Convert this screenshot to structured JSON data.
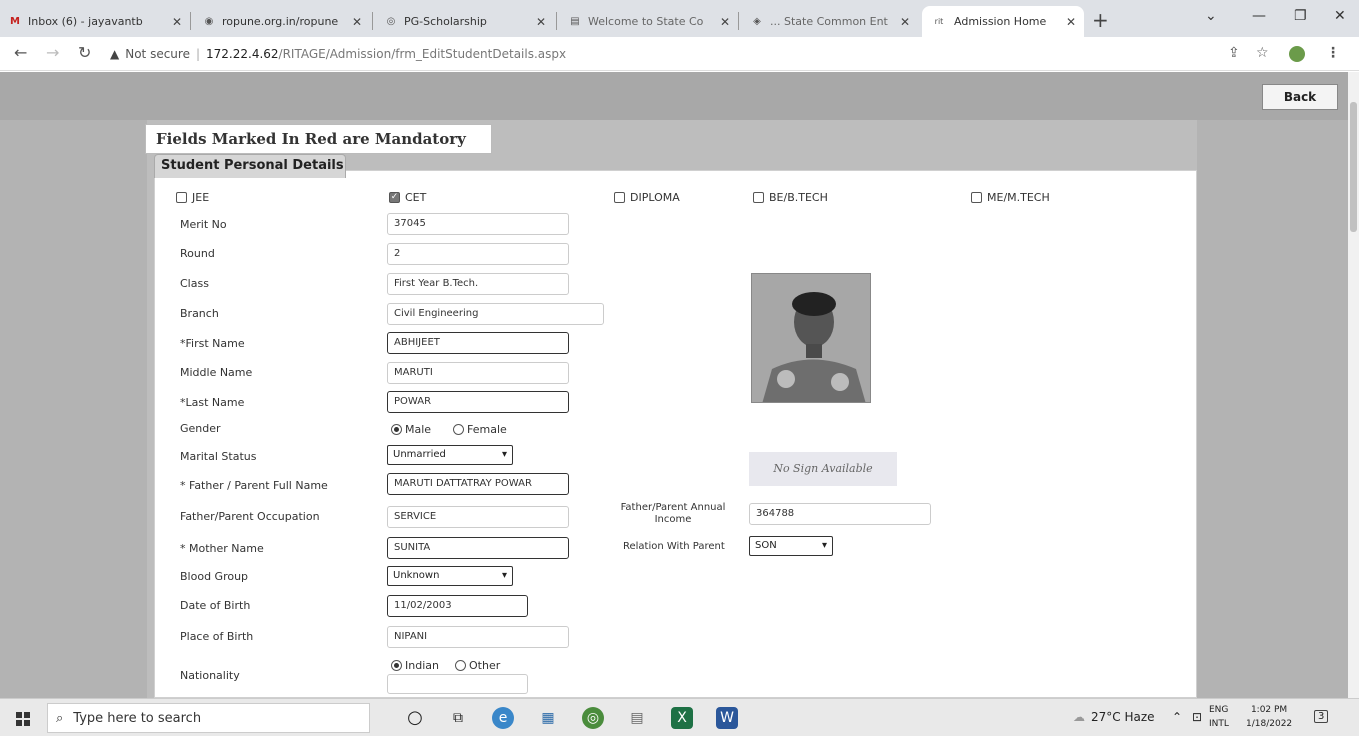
{
  "browser": {
    "tabs": [
      {
        "label": "Inbox (6) - jayavantb",
        "icon": "M"
      },
      {
        "label": "ropune.org.in/ropune",
        "icon": "◉"
      },
      {
        "label": "PG-Scholarship",
        "icon": "◎"
      },
      {
        "label": "Welcome to State Co",
        "icon": "▤"
      },
      {
        "label": "... State Common Ent",
        "icon": "◈"
      },
      {
        "label": "Admission Home",
        "icon": "rit"
      }
    ],
    "address": {
      "not_secure": "Not secure",
      "host": "172.22.4.62",
      "path": "/RITAGE/Admission/frm_EditStudentDetails.aspx"
    }
  },
  "page": {
    "back_label": "Back",
    "mandatory_note": "Fields Marked In Red are Mandatory",
    "section_title": "Student Personal Details",
    "exam_options": [
      {
        "label": "JEE",
        "checked": false
      },
      {
        "label": "CET",
        "checked": true
      },
      {
        "label": "DIPLOMA",
        "checked": false
      },
      {
        "label": "BE/B.TECH",
        "checked": false
      },
      {
        "label": "ME/M.TECH",
        "checked": false
      }
    ],
    "labels": {
      "merit_no": "Merit No",
      "round": "Round",
      "class": "Class",
      "branch": "Branch",
      "first_name": "First Name",
      "middle_name": "Middle Name",
      "last_name": "Last Name",
      "gender": "Gender",
      "marital_status": "Marital Status",
      "father_name": " Father / Parent Full Name",
      "father_occupation": "Father/Parent Occupation",
      "father_income": "Father/Parent Annual Income",
      "mother_name": " Mother Name",
      "relation": "Relation With Parent",
      "blood_group": "Blood Group",
      "dob": "Date of Birth",
      "pob": "Place of Birth",
      "nationality": "Nationality"
    },
    "required_mark": "*",
    "values": {
      "merit_no": "37045",
      "round": "2",
      "class": "First Year B.Tech.",
      "branch": "Civil Engineering",
      "first_name": "ABHIJEET",
      "middle_name": "MARUTI",
      "last_name": "POWAR",
      "marital_status": "Unmarried",
      "father_name": "MARUTI DATTATRAY POWAR",
      "father_occupation": "SERVICE",
      "father_income": "364788",
      "mother_name": "SUNITA",
      "relation": "SON",
      "blood_group": "Unknown",
      "dob": "11/02/2003",
      "pob": "NIPANI",
      "nationality_other": ""
    },
    "gender_options": [
      {
        "label": "Male",
        "selected": true
      },
      {
        "label": "Female",
        "selected": false
      }
    ],
    "nationality_options": [
      {
        "label": "Indian",
        "selected": true
      },
      {
        "label": "Other",
        "selected": false
      }
    ],
    "signature_text": "No Sign Available"
  },
  "taskbar": {
    "search_placeholder": "Type here to search",
    "weather": "27°C Haze",
    "lang_top": "ENG",
    "lang_bottom": "INTL",
    "time": "1:02 PM",
    "date": "1/18/2022",
    "notification_count": "3"
  }
}
